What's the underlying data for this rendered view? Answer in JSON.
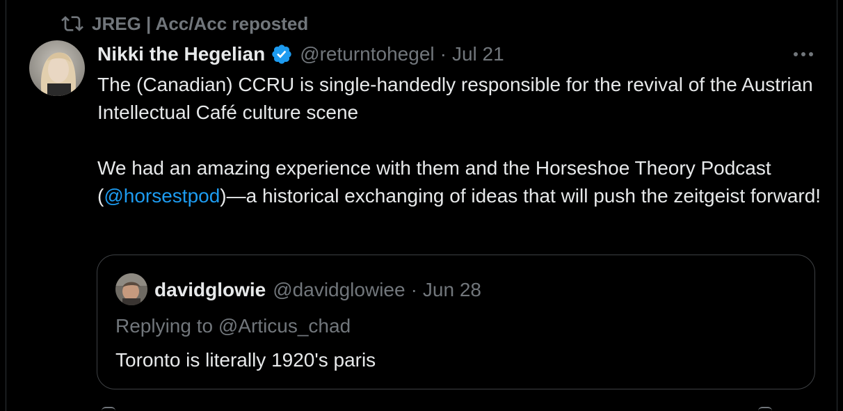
{
  "repost": {
    "icon": "repost-icon",
    "text": "JREG | Acc/Acc reposted"
  },
  "tweet": {
    "author_name": "Nikki the Hegelian",
    "verified_icon": "verified-badge-icon",
    "handle": "@returntohegel",
    "separator": "·",
    "date": "Jul 21",
    "more_icon": "more-options-icon",
    "paragraph1": "The (Canadian) CCRU is single-handedly responsible for the revival of the Austrian Intellectual Café culture scene",
    "paragraph2_before": "We had an amazing experience with them and the Horseshoe Theory Podcast (",
    "paragraph2_mention": "@horsestpod",
    "paragraph2_after": ")—a historical exchanging of ideas that will push the zeitgeist forward!"
  },
  "quote": {
    "author_name": "davidglowie",
    "handle": "@davidglowiee",
    "separator": "·",
    "date": "Jun 28",
    "replying_to": "Replying to @Articus_chad",
    "text": "Toronto is literally 1920's paris"
  },
  "colors": {
    "background": "#000000",
    "text": "#e7e9ea",
    "secondary": "#71767b",
    "link": "#1d9bf0",
    "border": "#2f3336"
  }
}
